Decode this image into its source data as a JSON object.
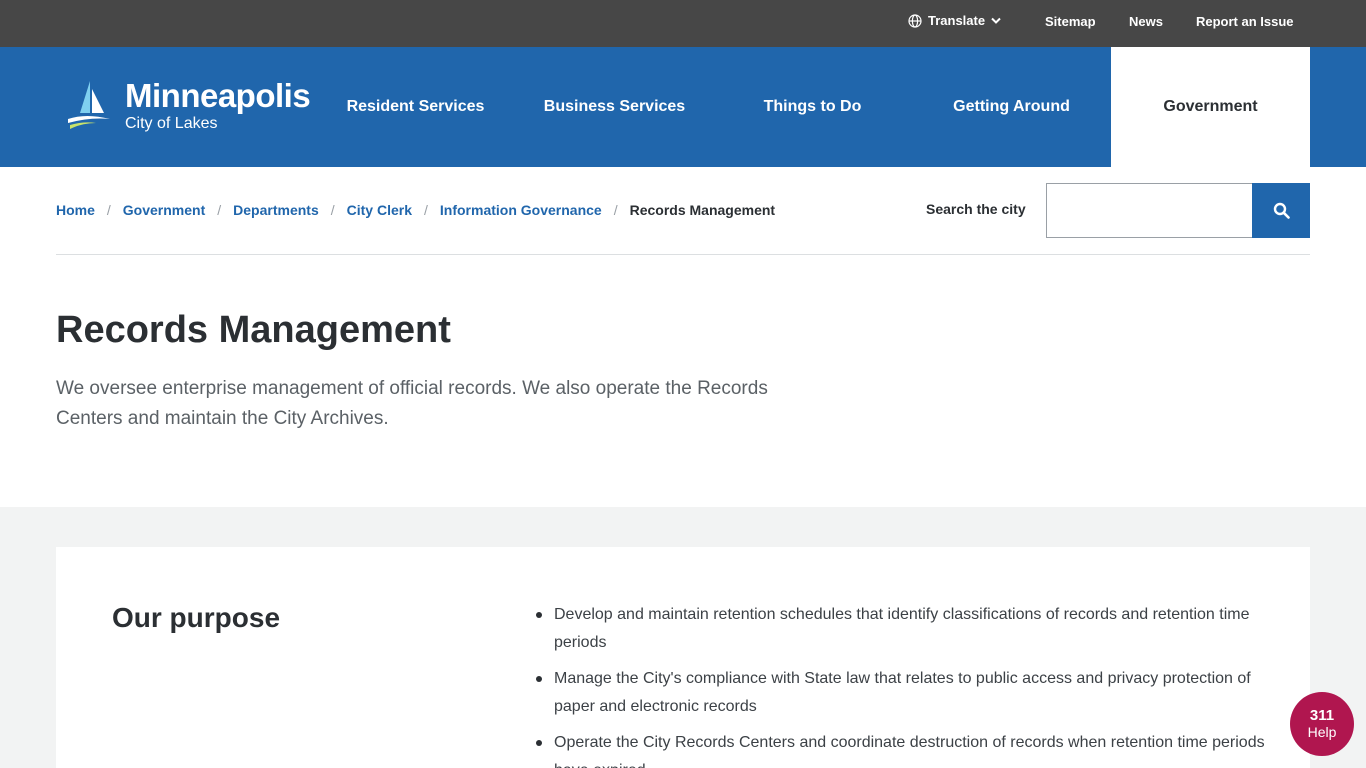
{
  "utility": {
    "translate_label": "Translate",
    "sitemap_label": "Sitemap",
    "news_label": "News",
    "report_label": "Report an Issue"
  },
  "logo": {
    "title": "Minneapolis",
    "subtitle": "City of Lakes"
  },
  "nav": {
    "items": [
      {
        "label": "Resident Services"
      },
      {
        "label": "Business Services"
      },
      {
        "label": "Things to Do"
      },
      {
        "label": "Getting Around"
      },
      {
        "label": "Government"
      }
    ]
  },
  "breadcrumb": {
    "items": [
      {
        "label": "Home"
      },
      {
        "label": "Government"
      },
      {
        "label": "Departments"
      },
      {
        "label": "City Clerk"
      },
      {
        "label": "Information Governance"
      }
    ],
    "current": "Records Management",
    "separator": "/"
  },
  "search": {
    "label": "Search the city",
    "value": ""
  },
  "page": {
    "title": "Records Management",
    "intro": "We oversee enterprise management of official records. We also operate the Records Centers and maintain the City Archives."
  },
  "purpose": {
    "title": "Our purpose",
    "items": [
      "Develop and maintain retention schedules that identify classifications of records and retention time periods",
      "Manage the City's compliance with State law that relates to public access and privacy protection of paper and electronic records",
      "Operate the City Records Centers and coordinate destruction of records when retention time periods have expired."
    ]
  },
  "help": {
    "number": "311",
    "label": "Help"
  },
  "colors": {
    "brand_blue": "#2066ac",
    "utility_bar": "#474747",
    "help_bubble": "#b0164f"
  }
}
